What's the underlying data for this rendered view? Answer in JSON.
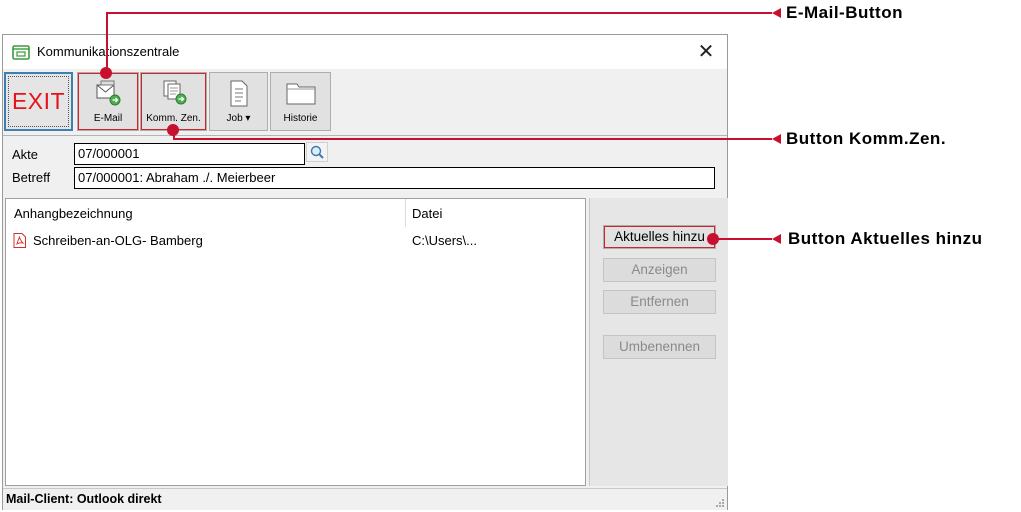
{
  "window": {
    "title": "Kommunikationszentrale",
    "close_label": "✕"
  },
  "toolbar": {
    "exit_label": "EXIT",
    "email_label": "E-Mail",
    "kommzen_label": "Komm. Zen.",
    "job_label": "Job ▾",
    "historie_label": "Historie"
  },
  "fields": {
    "akte_label": "Akte",
    "akte_value": "07/000001",
    "betreff_label": "Betreff",
    "betreff_value": "07/000001: Abraham ./. Meierbeer"
  },
  "list": {
    "headers": [
      "Anhangbezeichnung",
      "Datei"
    ],
    "rows": [
      {
        "name": "Schreiben-an-OLG- Bamberg",
        "path": "C:\\Users\\..."
      }
    ]
  },
  "side_buttons": {
    "aktuelles": "Aktuelles hinzu",
    "anzeigen": "Anzeigen",
    "entfernen": "Entfernen",
    "umbenennen": "Umbenennen"
  },
  "status": {
    "text": "Mail-Client: Outlook direkt"
  },
  "callouts": {
    "email": "E-Mail-Button",
    "kommzen": "Button Komm.Zen.",
    "aktuelles": "Button Aktuelles hinzu"
  },
  "colors": {
    "annotation": "#c8102e",
    "exit_text": "#e8131a",
    "focus_border": "#3c7fb1"
  },
  "icons": [
    "app-folder-icon",
    "close-icon",
    "email-icon",
    "kommzen-icon",
    "job-document-icon",
    "historie-folder-icon",
    "search-icon",
    "pdf-icon",
    "resize-grip-icon"
  ]
}
